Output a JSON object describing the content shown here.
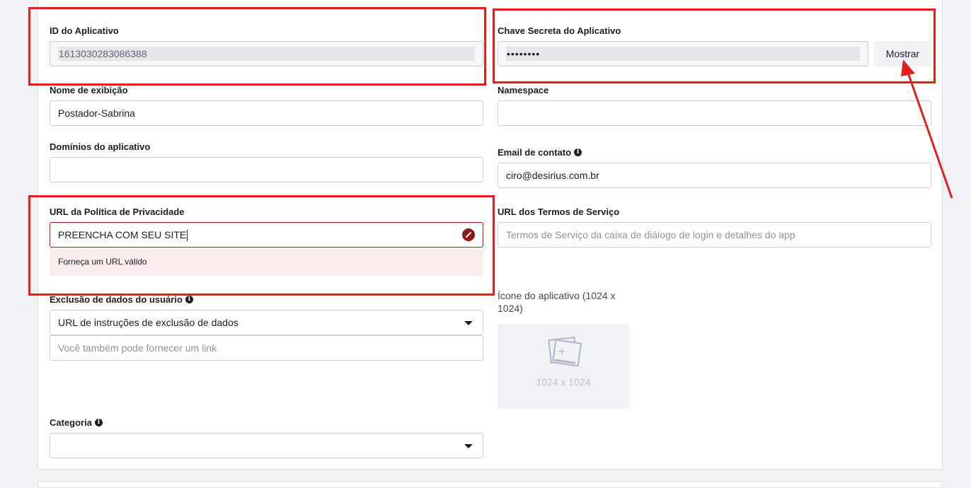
{
  "fields": {
    "app_id": {
      "label": "ID do Aplicativo",
      "value": "1613030283086388"
    },
    "app_secret": {
      "label": "Chave Secreta do Aplicativo",
      "value": "••••••••",
      "show_button": "Mostrar"
    },
    "display_name": {
      "label": "Nome de exibição",
      "value": "Postador-Sabrina"
    },
    "namespace": {
      "label": "Namespace",
      "value": ""
    },
    "app_domains": {
      "label": "Domínios do aplicativo",
      "value": ""
    },
    "contact_email": {
      "label": "Email de contato",
      "value": "ciro@desirius.com.br"
    },
    "privacy_url": {
      "label": "URL da Política de Privacidade",
      "value": "PREENCHA COM SEU SITE",
      "error": "Forneça um URL válido"
    },
    "terms_url": {
      "label": "URL dos Termos de Serviço",
      "placeholder": "Termos de Serviço da caixa de diálogo de login e detalhes do app"
    },
    "data_deletion": {
      "label": "Exclusão de dados do usuário",
      "selected": "URL de instruções de exclusão de dados",
      "link_placeholder": "Você também pode fornecer um link"
    },
    "app_icon": {
      "label": "Ícone do aplicativo (1024 x 1024)",
      "size_text": "1024 x 1024"
    },
    "category": {
      "label": "Categoria",
      "selected": ""
    }
  },
  "icons": {
    "info": "info-icon",
    "error": "error-icon",
    "dropdown": "chevron-down-icon",
    "image": "image-placeholder-icon"
  },
  "colors": {
    "annotation": "#e0201c",
    "error_border": "#be1717",
    "error_bg": "#fbeded"
  }
}
